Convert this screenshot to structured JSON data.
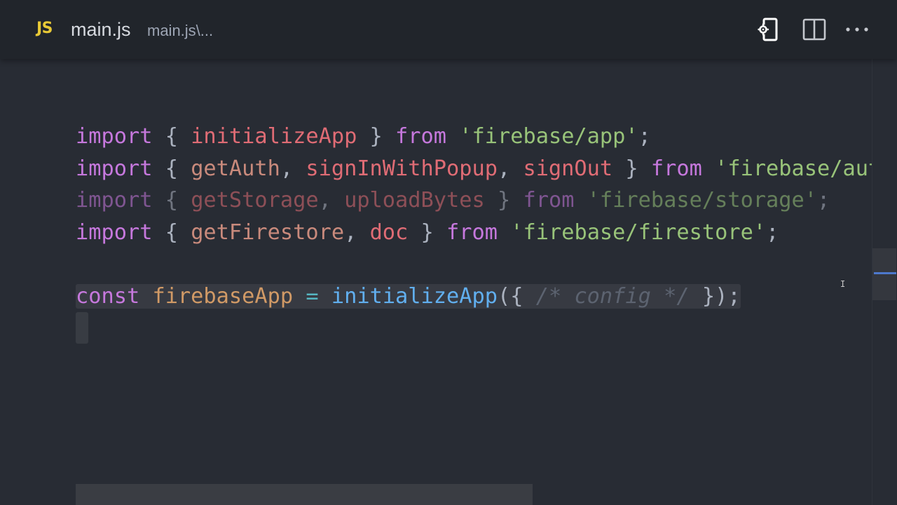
{
  "tab": {
    "lang_badge": "JS",
    "title": "main.js",
    "description": "main.js\\..."
  },
  "toolbar": {
    "icons": [
      "open-changes-icon",
      "split-editor-icon",
      "more-actions-icon"
    ]
  },
  "code_lines": [
    {
      "tokens": [
        {
          "t": "import",
          "c": "kw"
        },
        {
          "t": " { ",
          "c": "pn"
        },
        {
          "t": "initializeApp",
          "c": "fn"
        },
        {
          "t": " } ",
          "c": "pn"
        },
        {
          "t": "from",
          "c": "kw"
        },
        {
          "t": " ",
          "c": "pn"
        },
        {
          "t": "'firebase/app'",
          "c": "str"
        },
        {
          "t": ";",
          "c": "pn"
        }
      ]
    },
    {
      "tokens": [
        {
          "t": "import",
          "c": "kw"
        },
        {
          "t": " { ",
          "c": "pn"
        },
        {
          "t": "getAuth",
          "c": "fn2"
        },
        {
          "t": ", ",
          "c": "pn"
        },
        {
          "t": "signInWithPopup",
          "c": "fn"
        },
        {
          "t": ", ",
          "c": "pn"
        },
        {
          "t": "signOut",
          "c": "fn"
        },
        {
          "t": " } ",
          "c": "pn"
        },
        {
          "t": "from",
          "c": "kw"
        },
        {
          "t": " ",
          "c": "pn"
        },
        {
          "t": "'firebase/auth",
          "c": "str"
        }
      ]
    },
    {
      "dim": true,
      "tokens": [
        {
          "t": "import",
          "c": "kw"
        },
        {
          "t": " { ",
          "c": "pn"
        },
        {
          "t": "getStorage",
          "c": "fn"
        },
        {
          "t": ", ",
          "c": "pn"
        },
        {
          "t": "uploadBytes",
          "c": "fn"
        },
        {
          "t": " } ",
          "c": "pn"
        },
        {
          "t": "from",
          "c": "kw"
        },
        {
          "t": " ",
          "c": "pn"
        },
        {
          "t": "'firebase/storage'",
          "c": "str"
        },
        {
          "t": ";",
          "c": "pn"
        }
      ]
    },
    {
      "tokens": [
        {
          "t": "import",
          "c": "kw"
        },
        {
          "t": " { ",
          "c": "pn"
        },
        {
          "t": "getFirestore",
          "c": "fn2"
        },
        {
          "t": ", ",
          "c": "pn"
        },
        {
          "t": "doc",
          "c": "fn"
        },
        {
          "t": " } ",
          "c": "pn"
        },
        {
          "t": "from",
          "c": "kw"
        },
        {
          "t": " ",
          "c": "pn"
        },
        {
          "t": "'firebase/firestore'",
          "c": "str"
        },
        {
          "t": ";",
          "c": "pn"
        }
      ]
    },
    {
      "tokens": []
    },
    {
      "hl": true,
      "tokens": [
        {
          "t": "const",
          "c": "kw"
        },
        {
          "t": " ",
          "c": "pn"
        },
        {
          "t": "firebaseApp",
          "c": "var"
        },
        {
          "t": " ",
          "c": "pn"
        },
        {
          "t": "=",
          "c": "op"
        },
        {
          "t": " ",
          "c": "pn"
        },
        {
          "t": "initializeApp",
          "c": "call"
        },
        {
          "t": "({ ",
          "c": "pn"
        },
        {
          "t": "/* config */",
          "c": "cmt"
        },
        {
          "t": " });",
          "c": "pn"
        }
      ]
    },
    {
      "cursor": true,
      "tokens": []
    }
  ],
  "colors": {
    "background": "#282c34",
    "tabbar": "#21252b",
    "keyword": "#c678dd",
    "identifier": "#e06c75",
    "string": "#98c379",
    "function_call": "#61afef",
    "variable": "#d19a66",
    "js_badge": "#e8c936"
  }
}
